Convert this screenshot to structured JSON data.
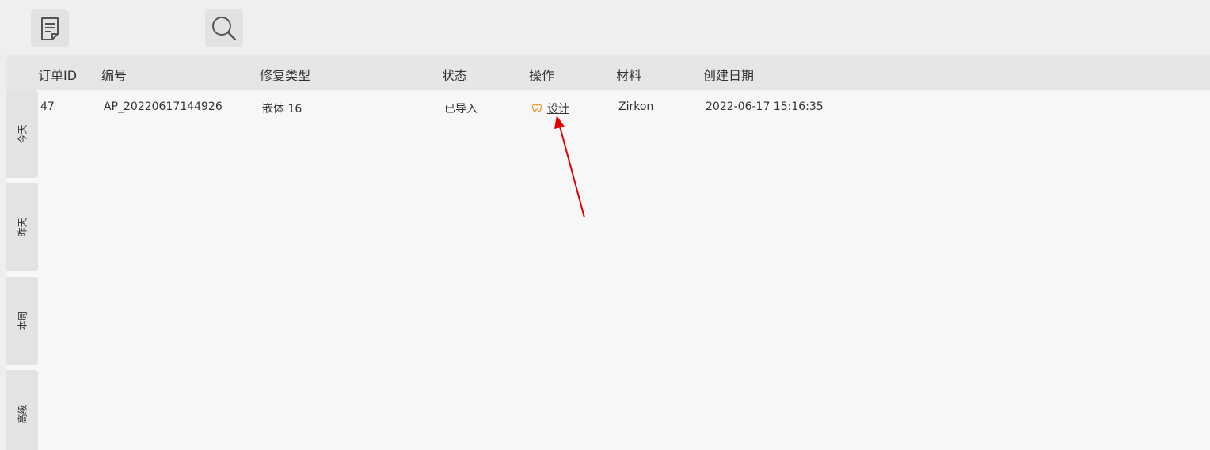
{
  "toolbar": {
    "doc_icon": "document-list-icon",
    "search_placeholder": "",
    "search_value": "",
    "search_icon": "search-icon"
  },
  "table": {
    "headers": [
      "订单ID",
      "编号",
      "修复类型",
      "状态",
      "操作",
      "材料",
      "创建日期"
    ],
    "rows": [
      {
        "order_id": "47",
        "code": "AP_20220617144926",
        "repair_type": "嵌体 16",
        "status": "已导入",
        "action_icon": "tooth-icon",
        "action": "设计",
        "material": "Zirkon",
        "created": "2022-06-17 15:16:35"
      }
    ]
  },
  "side_tabs": [
    "今天",
    "昨天",
    "本周",
    "高级"
  ],
  "annotation": {
    "arrow_color": "#e00000"
  },
  "colors": {
    "accent_icon": "#e8963a"
  }
}
